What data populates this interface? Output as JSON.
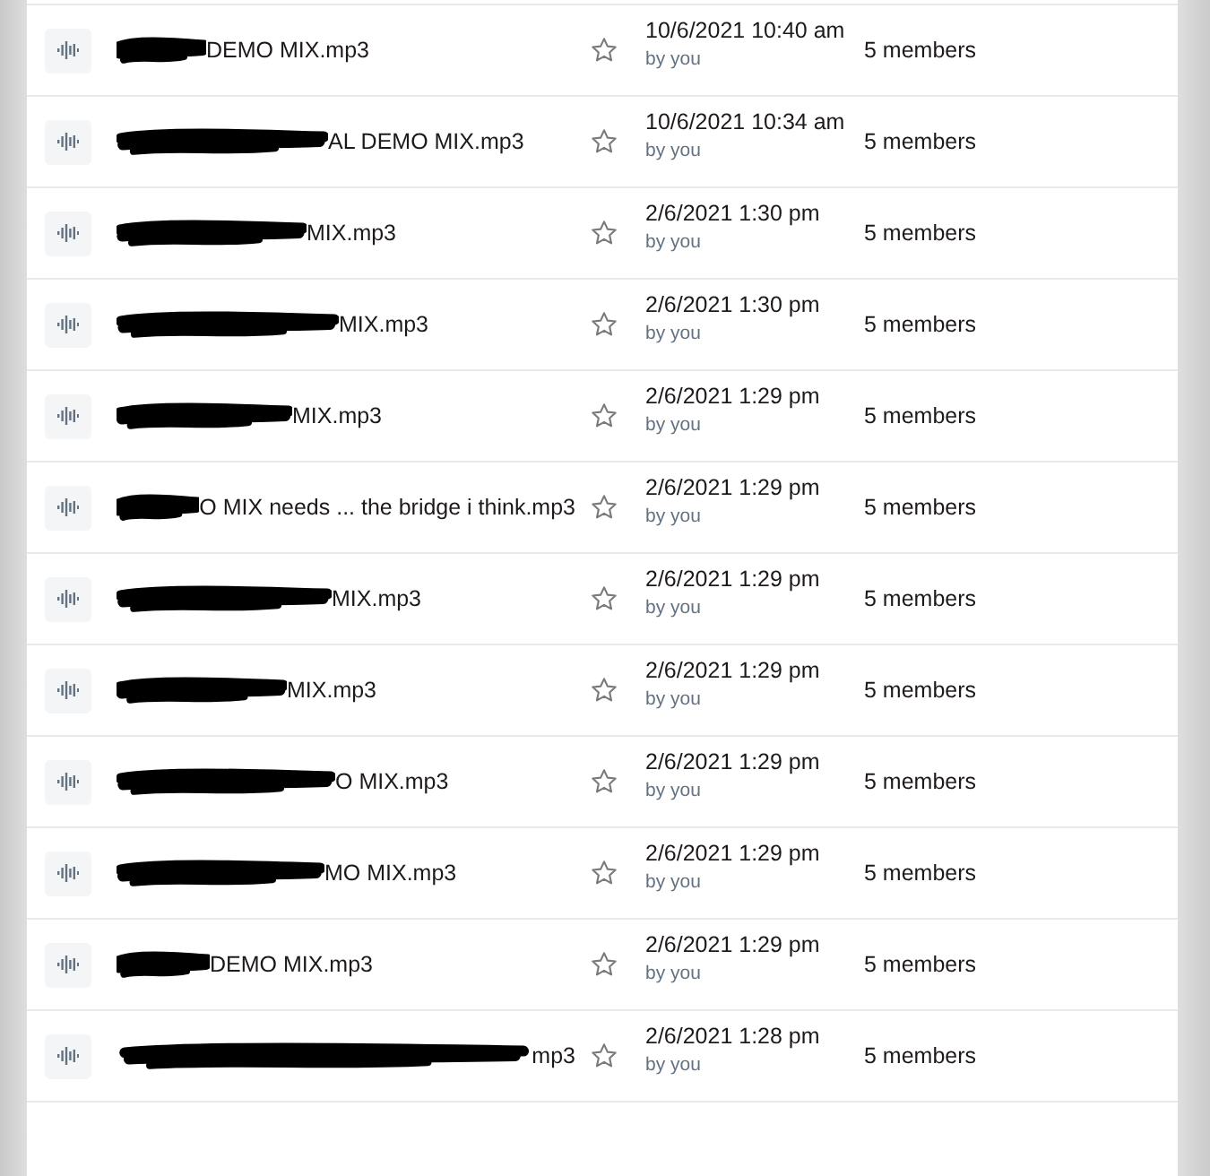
{
  "files": [
    {
      "name": "DEMO MIX.mp3",
      "redacted": true,
      "starred": false,
      "modified": "10/6/2021 10:40 am",
      "modified_by": "by you",
      "sharing": "5 members"
    },
    {
      "name": "AL DEMO MIX.mp3",
      "redacted": true,
      "starred": false,
      "modified": "10/6/2021 10:34 am",
      "modified_by": "by you",
      "sharing": "5 members"
    },
    {
      "name": "MIX.mp3",
      "redacted": true,
      "starred": false,
      "modified": "2/6/2021 1:30 pm",
      "modified_by": "by you",
      "sharing": "5 members"
    },
    {
      "name": "MIX.mp3",
      "redacted": true,
      "starred": false,
      "modified": "2/6/2021 1:30 pm",
      "modified_by": "by you",
      "sharing": "5 members"
    },
    {
      "name": "MIX.mp3",
      "redacted": true,
      "starred": false,
      "modified": "2/6/2021 1:29 pm",
      "modified_by": "by you",
      "sharing": "5 members"
    },
    {
      "name": "O MIX needs ... the bridge i think.mp3",
      "redacted": true,
      "starred": false,
      "modified": "2/6/2021 1:29 pm",
      "modified_by": "by you",
      "sharing": "5 members"
    },
    {
      "name": "MIX.mp3",
      "redacted": true,
      "starred": false,
      "modified": "2/6/2021 1:29 pm",
      "modified_by": "by you",
      "sharing": "5 members"
    },
    {
      "name": "MIX.mp3",
      "redacted": true,
      "starred": false,
      "modified": "2/6/2021 1:29 pm",
      "modified_by": "by you",
      "sharing": "5 members"
    },
    {
      "name": "O MIX.mp3",
      "redacted": true,
      "starred": false,
      "modified": "2/6/2021 1:29 pm",
      "modified_by": "by you",
      "sharing": "5 members"
    },
    {
      "name": "MO MIX.mp3",
      "redacted": true,
      "starred": false,
      "modified": "2/6/2021 1:29 pm",
      "modified_by": "by you",
      "sharing": "5 members"
    },
    {
      "name": "DEMO MIX.mp3",
      "redacted": true,
      "starred": false,
      "modified": "2/6/2021 1:29 pm",
      "modified_by": "by you",
      "sharing": "5 members"
    },
    {
      "name": "mp3",
      "redacted": true,
      "starred": false,
      "modified": "2/6/2021 1:28 pm",
      "modified_by": "by you",
      "sharing": "5 members"
    }
  ]
}
